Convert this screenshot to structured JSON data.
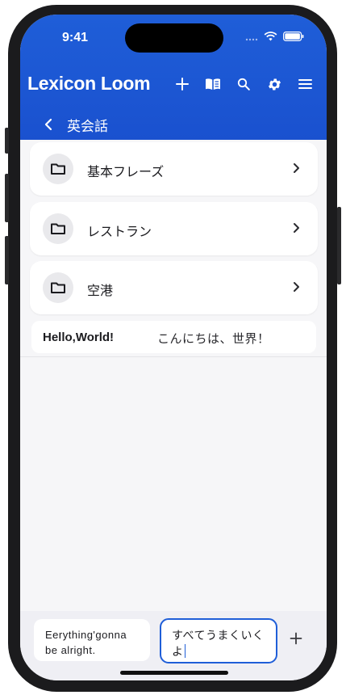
{
  "status_bar": {
    "time": "9:41"
  },
  "app": {
    "title": "Lexicon Loom",
    "actions": [
      "add-icon",
      "book-icon",
      "search-icon",
      "gear-icon",
      "menu-icon"
    ]
  },
  "breadcrumb": {
    "label": "英会話"
  },
  "folders": [
    {
      "label": "基本フレーズ"
    },
    {
      "label": "レストラン"
    },
    {
      "label": "空港"
    }
  ],
  "phrases": [
    {
      "english": "Hello,World!",
      "japanese": "こんにちは、世界！"
    }
  ],
  "composer": {
    "english_value": "Eerything'gonna be alright.",
    "japanese_value": "すべてうまくいくよ"
  },
  "colors": {
    "accent": "#1f5ed8",
    "header": "#1a51cf",
    "background": "#f6f6f8"
  }
}
